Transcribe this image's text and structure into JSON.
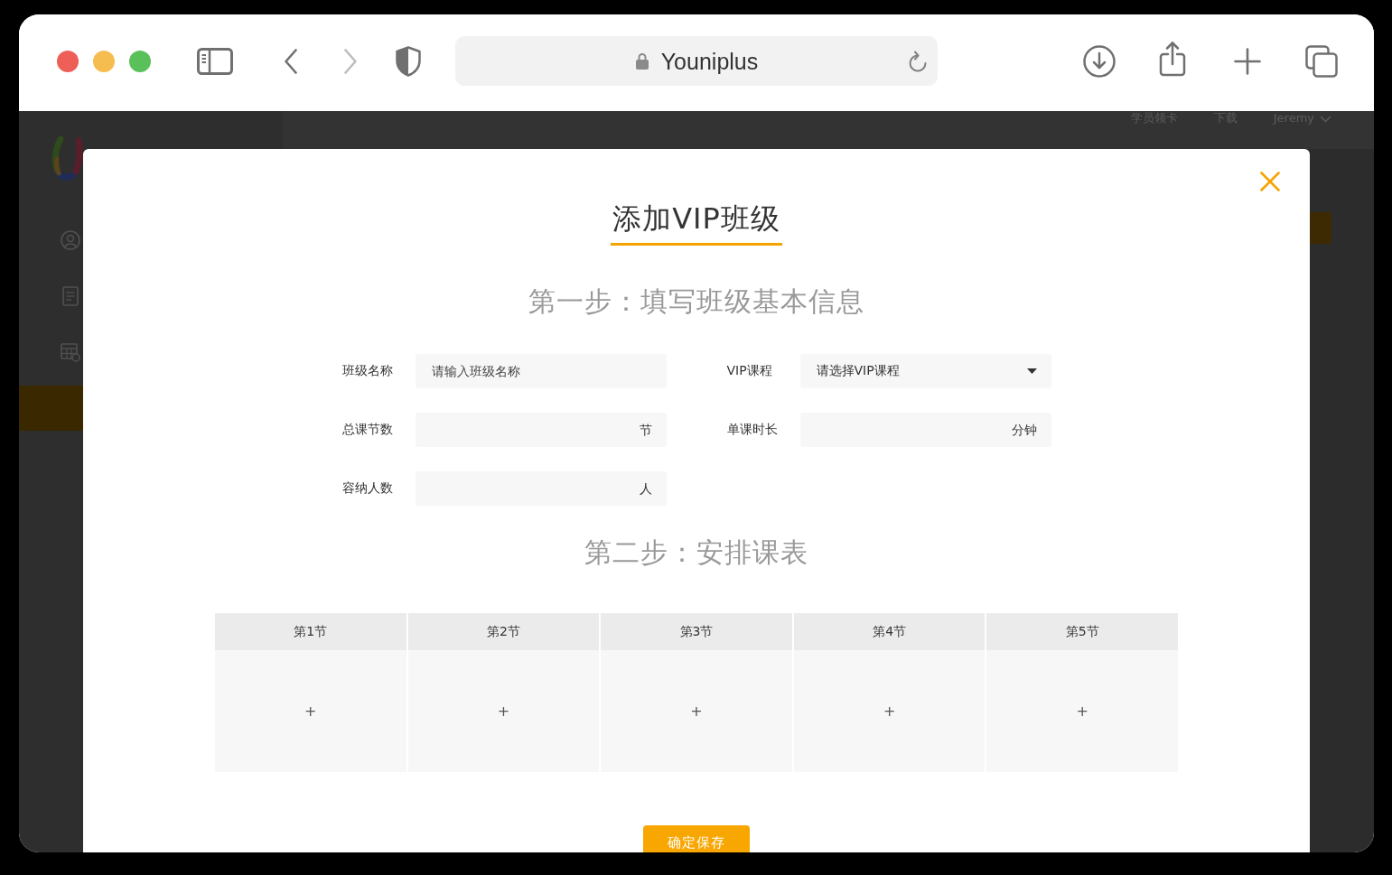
{
  "browser": {
    "address": "Youniplus",
    "back": {
      "disabled": false
    },
    "forward": {
      "disabled": true
    }
  },
  "header": {
    "links": [
      "学员领卡",
      "下载"
    ],
    "user": "Jeremy"
  },
  "sidebar": {
    "items": [
      {
        "kind": "person",
        "selected": false
      },
      {
        "kind": "document",
        "selected": false
      },
      {
        "kind": "calendar",
        "selected": false
      },
      {
        "kind": "none",
        "selected": true
      }
    ]
  },
  "modal": {
    "title": "添加VIP班级",
    "step1": "第一步：填写班级基本信息",
    "fields": [
      {
        "label": "班级名称",
        "kind": "text",
        "placeholder": "请输入班级名称"
      },
      {
        "label": "VIP课程",
        "kind": "select",
        "placeholder": "请选择VIP课程"
      },
      {
        "label": "总课节数",
        "kind": "number",
        "unit": "节"
      },
      {
        "label": "单课时长",
        "kind": "number",
        "unit": "分钟"
      },
      {
        "label": "容纳人数",
        "kind": "number",
        "unit": "人"
      }
    ],
    "step2": "第二步：安排课表",
    "schedule": [
      {
        "header": "第1节",
        "add": "+"
      },
      {
        "header": "第2节",
        "add": "+"
      },
      {
        "header": "第3节",
        "add": "+"
      },
      {
        "header": "第4节",
        "add": "+"
      },
      {
        "header": "第5节",
        "add": "+"
      }
    ],
    "save_button": "确定保存"
  }
}
